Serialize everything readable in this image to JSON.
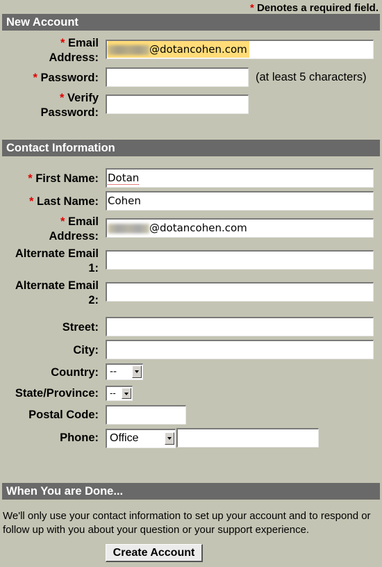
{
  "required_note": {
    "star": "*",
    "text": "Denotes a required field."
  },
  "new_account": {
    "title": "New Account",
    "email_label_1": "Email",
    "email_label_2": "Address:",
    "email_value_suffix": "@dotancohen.com",
    "password_label": "Password:",
    "password_hint": "(at least 5 characters)",
    "verify_label_1": "Verify",
    "verify_label_2": "Password:"
  },
  "contact": {
    "title": "Contact Information",
    "first_name_label": "First Name:",
    "first_name_value": "Dotan",
    "last_name_label": "Last Name:",
    "last_name_value": "Cohen",
    "email_label_1": "Email",
    "email_label_2": "Address:",
    "email_value_suffix": "@dotancohen.com",
    "alt1_label_1": "Alternate Email",
    "alt1_label_2": "1:",
    "alt2_label_1": "Alternate Email",
    "alt2_label_2": "2:",
    "street_label": "Street:",
    "city_label": "City:",
    "country_label": "Country:",
    "country_value": "--",
    "state_label": "State/Province:",
    "state_value": "--",
    "postal_label": "Postal Code:",
    "phone_label": "Phone:",
    "phone_type_value": "Office"
  },
  "done": {
    "title": "When You are Done...",
    "text": "We'll only use your contact information to set up your account and to respond or follow up with you about your question or your support experience.",
    "create_button": "Create Account"
  },
  "star": "*"
}
